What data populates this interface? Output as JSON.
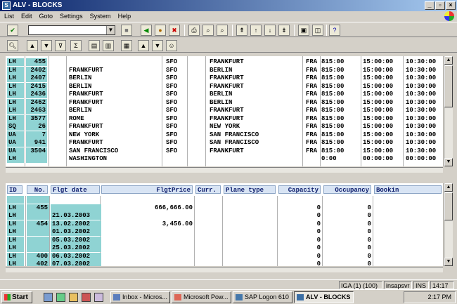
{
  "window": {
    "title": "ALV - BLOCKS"
  },
  "menu": [
    "List",
    "Edit",
    "Goto",
    "Settings",
    "System",
    "Help"
  ],
  "toolbar": {
    "command_value": ""
  },
  "grid1": {
    "rows": [
      [
        "LH",
        "455",
        "",
        "SFO",
        "",
        "FRANKFURT",
        "FRA",
        "815:00",
        "15:00:00",
        "10:30:00"
      ],
      [
        "LH",
        "2402",
        "FRANKFURT",
        "SFO",
        "",
        "BERLIN",
        "FRA",
        "815:00",
        "15:00:00",
        "10:30:00"
      ],
      [
        "LH",
        "2407",
        "BERLIN",
        "SFO",
        "",
        "FRANKFURT",
        "FRA",
        "815:00",
        "15:00:00",
        "10:30:00"
      ],
      [
        "LH",
        "2415",
        "BERLIN",
        "SFO",
        "",
        "FRANKFURT",
        "FRA",
        "815:00",
        "15:00:00",
        "10:30:00"
      ],
      [
        "LH",
        "2436",
        "FRANKFURT",
        "SFO",
        "",
        "BERLIN",
        "FRA",
        "815:00",
        "15:00:00",
        "10:30:00"
      ],
      [
        "LH",
        "2462",
        "FRANKFURT",
        "SFO",
        "",
        "BERLIN",
        "FRA",
        "815:00",
        "15:00:00",
        "10:30:00"
      ],
      [
        "LH",
        "2463",
        "BERLIN",
        "SFO",
        "",
        "FRANKFURT",
        "FRA",
        "815:00",
        "15:00:00",
        "10:30:00"
      ],
      [
        "LH",
        "3577",
        "ROME",
        "SFO",
        "",
        "FRANKFURT",
        "FRA",
        "815:00",
        "15:00:00",
        "10:30:00"
      ],
      [
        "SQ",
        "26",
        "FRANKFURT",
        "SFO",
        "",
        "NEW YORK",
        "FRA",
        "815:00",
        "15:00:00",
        "10:30:00"
      ],
      [
        "UA",
        "7",
        "NEW YORK",
        "SFO",
        "",
        "SAN FRANCISCO",
        "FRA",
        "815:00",
        "15:00:00",
        "10:30:00"
      ],
      [
        "UA",
        "941",
        "FRANKFURT",
        "SFO",
        "",
        "SAN FRANCISCO",
        "FRA",
        "815:00",
        "15:00:00",
        "10:30:00"
      ],
      [
        "UA",
        "3504",
        "SAN FRANCISCO",
        "SFO",
        "",
        "FRANKFURT",
        "FRA",
        "815:00",
        "15:00:00",
        "10:30:00"
      ],
      [
        "LH",
        "",
        "WASHINGTON",
        "",
        "",
        "",
        "",
        "0:00",
        "00:00:00",
        "00:00:00"
      ]
    ]
  },
  "grid2": {
    "headers": [
      "ID",
      "No.",
      "Flgt date",
      "FlgtPrice",
      "Curr.",
      "Plane type",
      "Capacity",
      "Occupancy",
      "Bookin"
    ],
    "rows": [
      [
        "",
        "",
        "",
        "",
        "",
        "",
        "",
        "",
        ""
      ],
      [
        "LH",
        "455",
        "",
        "666,666.00",
        "",
        "",
        "0",
        "0",
        ""
      ],
      [
        "LH",
        "",
        "21.03.2003",
        "",
        "",
        "",
        "0",
        "0",
        ""
      ],
      [
        "LH",
        "454",
        "13.02.2002",
        "3,456.00",
        "",
        "",
        "0",
        "0",
        ""
      ],
      [
        "LH",
        "",
        "01.03.2002",
        "",
        "",
        "",
        "0",
        "0",
        ""
      ],
      [
        "LH",
        "",
        "05.03.2002",
        "",
        "",
        "",
        "0",
        "0",
        ""
      ],
      [
        "LH",
        "",
        "25.03.2002",
        "",
        "",
        "",
        "0",
        "0",
        ""
      ],
      [
        "LH",
        "400",
        "06.03.2002",
        "",
        "",
        "",
        "0",
        "0",
        ""
      ],
      [
        "LH",
        "402",
        "07.03.2002",
        "",
        "",
        "",
        "0",
        "0",
        ""
      ]
    ]
  },
  "status": {
    "session": "IGA (1) (100)",
    "server": "insapsvr",
    "mode": "INS",
    "time": "14:17"
  },
  "taskbar": {
    "start": "Start",
    "tasks": [
      "Inbox - Micros...",
      "Microsoft Pow...",
      "SAP Logon 610",
      "ALV - BLOCKS"
    ],
    "clock": "2:17 PM"
  }
}
